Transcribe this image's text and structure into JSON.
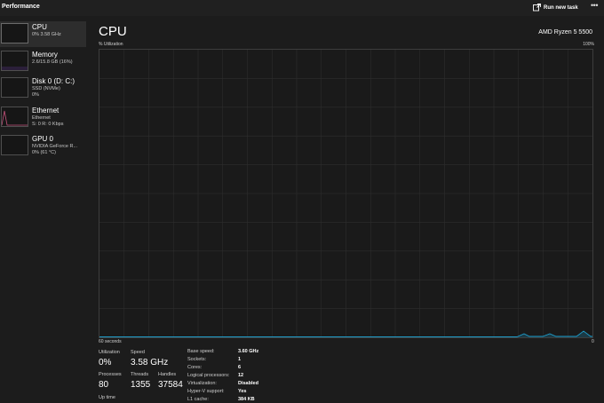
{
  "app": {
    "title": "Performance"
  },
  "toolbar": {
    "run_new_task": "Run new task",
    "more_icon": "more-dots-icon"
  },
  "sidebar": {
    "items": [
      {
        "name": "CPU",
        "lines": [
          "0%  3.58 GHz"
        ],
        "selected": true,
        "graph_color": "#1e9bc8"
      },
      {
        "name": "Memory",
        "lines": [
          "2.6/15.8 GB (16%)"
        ],
        "selected": false,
        "graph_color": "#7f3fbf"
      },
      {
        "name": "Disk 0 (D: C:)",
        "lines": [
          "SSD (NVMe)",
          "0%"
        ],
        "selected": false,
        "graph_color": "#4caf50"
      },
      {
        "name": "Ethernet",
        "lines": [
          "Ethernet",
          "S: 0  R: 0 Kbps"
        ],
        "selected": false,
        "graph_color": "#c3527b"
      },
      {
        "name": "GPU 0",
        "lines": [
          "NVIDIA GeForce R...",
          "0%  (61 °C)"
        ],
        "selected": false,
        "graph_color": "#1e9bc8"
      }
    ]
  },
  "main": {
    "title": "CPU",
    "model": "AMD Ryzen 5 5500",
    "util_label": "% Utilization",
    "max_label": "100%",
    "min_label": "0",
    "time_span": "60 seconds",
    "accent_color": "#1e9bc8"
  },
  "stats": {
    "utilization": {
      "label": "Utilization",
      "value": "0%"
    },
    "speed": {
      "label": "Speed",
      "value": "3.58 GHz"
    },
    "processes": {
      "label": "Processes",
      "value": "80"
    },
    "threads": {
      "label": "Threads",
      "value": "1355"
    },
    "handles": {
      "label": "Handles",
      "value": "37584"
    },
    "uptime": {
      "label": "Up time"
    }
  },
  "specs": [
    {
      "key": "Base speed:",
      "value": "3.60 GHz"
    },
    {
      "key": "Sockets:",
      "value": "1"
    },
    {
      "key": "Cores:",
      "value": "6"
    },
    {
      "key": "Logical processors:",
      "value": "12"
    },
    {
      "key": "Virtualization:",
      "value": "Disabled"
    },
    {
      "key": "Hyper-V support:",
      "value": "Yes"
    },
    {
      "key": "L1 cache:",
      "value": "384 KB"
    }
  ]
}
